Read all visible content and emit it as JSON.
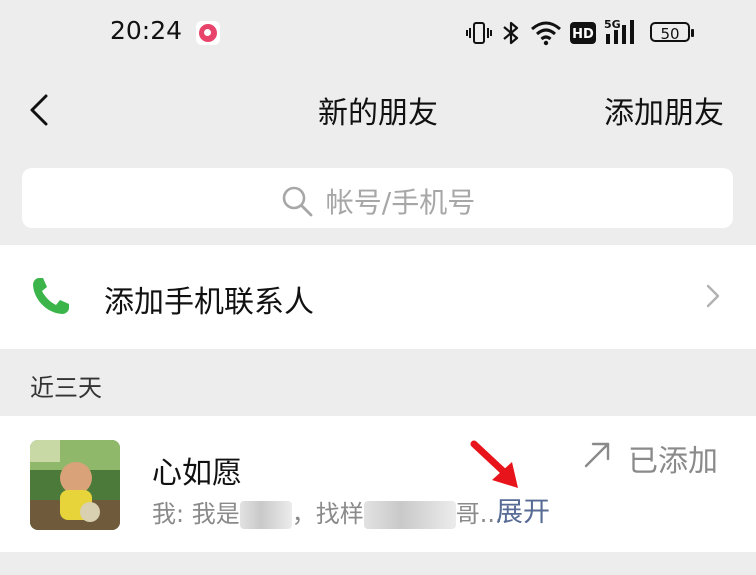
{
  "status_bar": {
    "time": "20:24",
    "icons": [
      "vibrate-icon",
      "bluetooth-icon",
      "wifi-icon",
      "hd-icon",
      "5g-signal-icon",
      "battery-icon"
    ],
    "hd_label": "HD",
    "network_label": "5G",
    "battery_level": "50"
  },
  "nav": {
    "title": "新的朋友",
    "action_label": "添加朋友"
  },
  "search": {
    "placeholder": "帐号/手机号"
  },
  "add_contacts": {
    "label": "添加手机联系人"
  },
  "section": {
    "title": "近三天"
  },
  "friend_requests": [
    {
      "name": "心如愿",
      "message_prefix": "我: 我是",
      "message_middle": "，找样",
      "message_suffix": "哥...",
      "expand_label": "展开",
      "status_label": "已添加"
    }
  ],
  "colors": {
    "background": "#ededed",
    "card": "#ffffff",
    "link": "#576b95",
    "phone_green": "#3bb54a",
    "annotation_red": "#e8141c"
  }
}
